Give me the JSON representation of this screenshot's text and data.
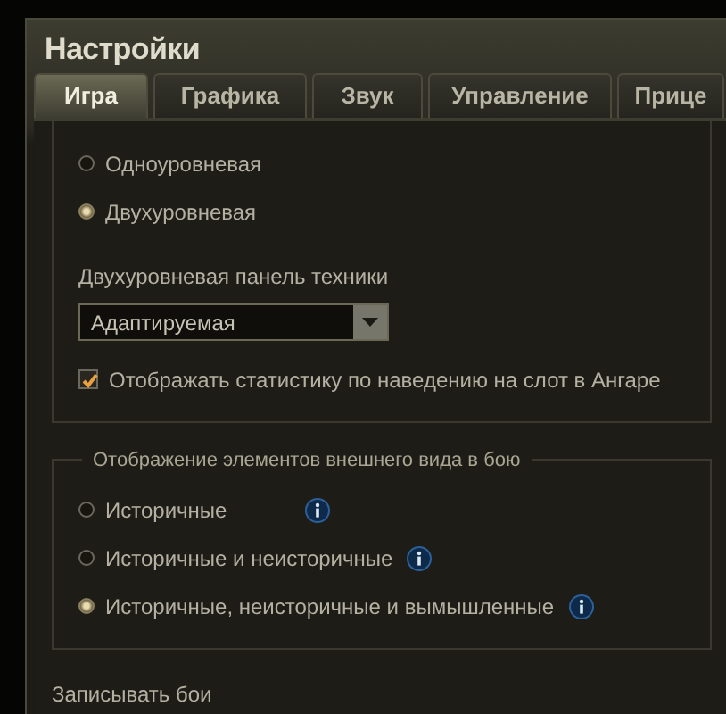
{
  "window": {
    "title": "Настройки"
  },
  "tabs": [
    {
      "label": "Игра",
      "selected": true
    },
    {
      "label": "Графика",
      "selected": false
    },
    {
      "label": "Звук",
      "selected": false
    },
    {
      "label": "Управление",
      "selected": false
    },
    {
      "label": "Прице",
      "selected": false
    }
  ],
  "panel_mode": {
    "options": [
      {
        "label": "Одноуровневая",
        "selected": false
      },
      {
        "label": "Двухуровневая",
        "selected": true
      }
    ]
  },
  "vehicle_panel": {
    "label": "Двухуровневая панель техники",
    "value": "Адаптируемая"
  },
  "stats_checkbox": {
    "label": "Отображать статистику по наведению на слот в Ангаре",
    "checked": true
  },
  "appearance": {
    "title": "Отображение элементов внешнего вида в бою",
    "options": [
      {
        "label": "Историчные",
        "selected": false
      },
      {
        "label": "Историчные и неисторичные",
        "selected": false
      },
      {
        "label": "Историчные, неисторичные и вымышленные",
        "selected": true
      }
    ]
  },
  "record_battles": {
    "label": "Записывать бои"
  }
}
